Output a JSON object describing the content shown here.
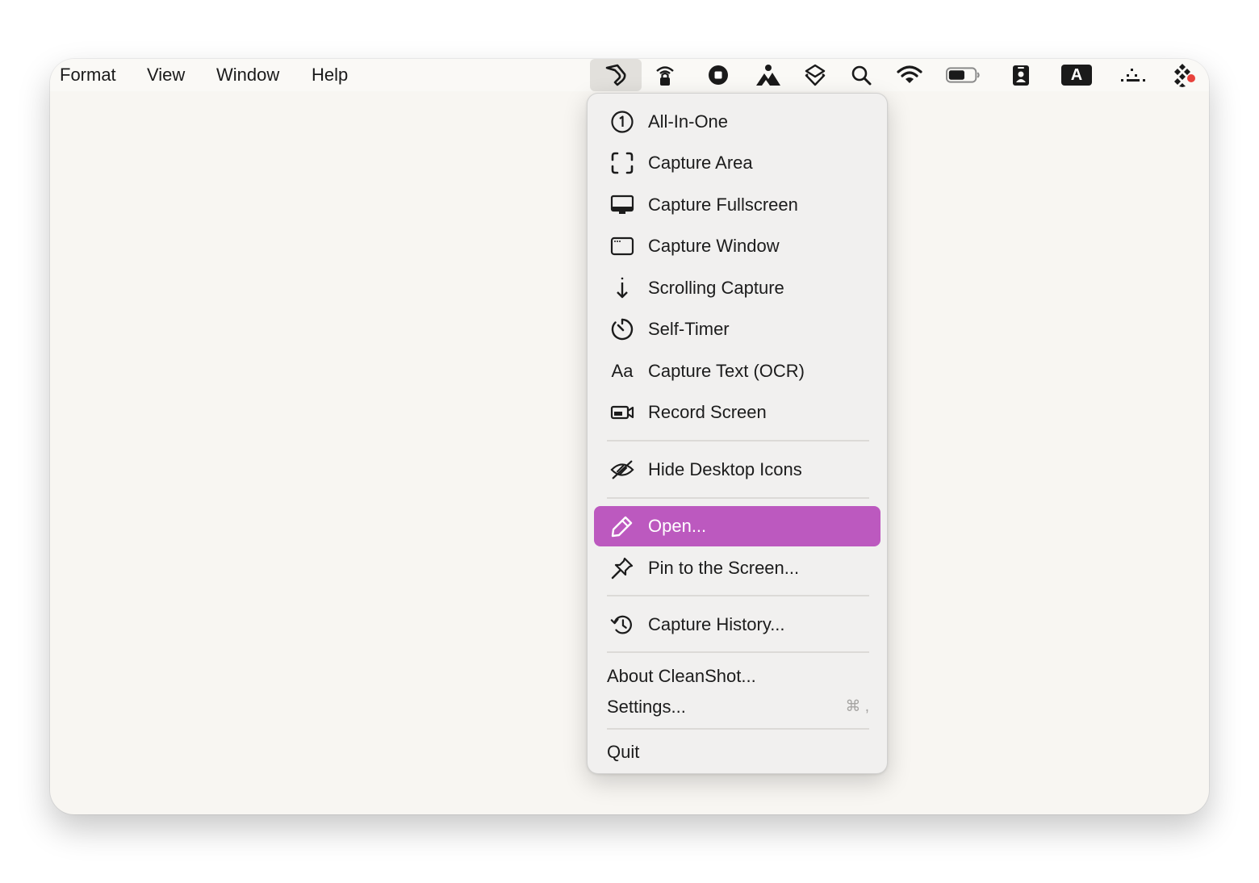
{
  "menubar": {
    "menus": [
      "Format",
      "View",
      "Window",
      "Help"
    ],
    "status_icons": [
      "cleanshot-icon",
      "airdrop-lock-icon",
      "record-stop-icon",
      "mountains-icon",
      "layers-icon",
      "search-icon",
      "wifi-icon",
      "battery-icon",
      "id-badge-icon",
      "input-source-icon",
      "dots-icon",
      "app-grid-icon"
    ],
    "input_source_label": "A"
  },
  "dropdown": {
    "items": [
      {
        "label": "All-In-One",
        "icon": "one-circle-icon"
      },
      {
        "label": "Capture Area",
        "icon": "capture-area-icon"
      },
      {
        "label": "Capture Fullscreen",
        "icon": "monitor-icon"
      },
      {
        "label": "Capture Window",
        "icon": "window-icon"
      },
      {
        "label": "Scrolling Capture",
        "icon": "arrow-down-icon"
      },
      {
        "label": "Self-Timer",
        "icon": "timer-icon"
      },
      {
        "label": "Capture Text (OCR)",
        "icon": "text-aa-icon",
        "glyph": "Aa"
      },
      {
        "label": "Record Screen",
        "icon": "video-camera-icon"
      },
      {
        "label": "Hide Desktop Icons",
        "icon": "eye-slash-icon"
      },
      {
        "label": "Open...",
        "icon": "pencil-icon",
        "highlighted": true
      },
      {
        "label": "Pin to the Screen...",
        "icon": "pin-icon"
      },
      {
        "label": "Capture History...",
        "icon": "history-icon"
      },
      {
        "label": "About CleanShot..."
      },
      {
        "label": "Settings...",
        "shortcut": "⌘ ,"
      },
      {
        "label": "Quit"
      }
    ]
  },
  "colors": {
    "highlight": "#bc59bf",
    "window_bg": "#f8f6f2",
    "menu_bg": "#f1f0ef",
    "badge_red": "#e8423c"
  }
}
